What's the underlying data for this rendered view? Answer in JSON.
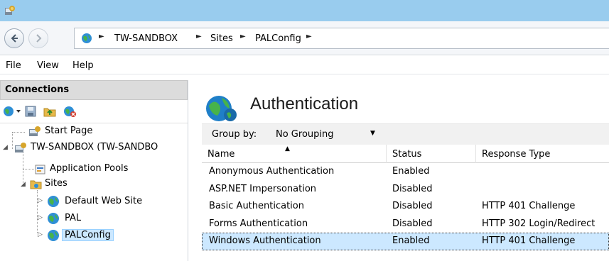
{
  "titlebar": {
    "icon": "iis-manager-icon"
  },
  "address": {
    "back_icon": "back-arrow-icon",
    "forward_icon": "forward-arrow-icon",
    "globe_icon": "globe-icon",
    "crumbs": [
      "TW-SANDBOX",
      "Sites",
      "PALConfig"
    ],
    "separator": "►"
  },
  "menu": {
    "items": [
      "File",
      "View",
      "Help"
    ]
  },
  "connections": {
    "header": "Connections",
    "toolbar_icons": [
      "connect-icon",
      "save-icon",
      "folder-up-icon",
      "disconnect-icon"
    ],
    "tree": {
      "start_page": "Start Page",
      "server": "TW-SANDBOX (TW-SANDBO",
      "app_pools": "Application Pools",
      "sites": "Sites",
      "site_default": "Default Web Site",
      "site_pal": "PAL",
      "site_palconfig": "PALConfig"
    }
  },
  "feature": {
    "title": "Authentication",
    "group_by_label": "Group by:",
    "group_by_value": "No Grouping",
    "columns": [
      "Name",
      "Status",
      "Response Type"
    ],
    "rows": [
      {
        "name": "Anonymous Authentication",
        "status": "Enabled",
        "response": ""
      },
      {
        "name": "ASP.NET Impersonation",
        "status": "Disabled",
        "response": ""
      },
      {
        "name": "Basic Authentication",
        "status": "Disabled",
        "response": "HTTP 401 Challenge"
      },
      {
        "name": "Forms Authentication",
        "status": "Disabled",
        "response": "HTTP 302 Login/Redirect"
      },
      {
        "name": "Windows Authentication",
        "status": "Enabled",
        "response": "HTTP 401 Challenge"
      }
    ],
    "selected_row": "Windows Authentication"
  },
  "colors": {
    "titlebar": "#99ccee",
    "selection": "#cce8ff",
    "accent": "#0a5fb4"
  }
}
